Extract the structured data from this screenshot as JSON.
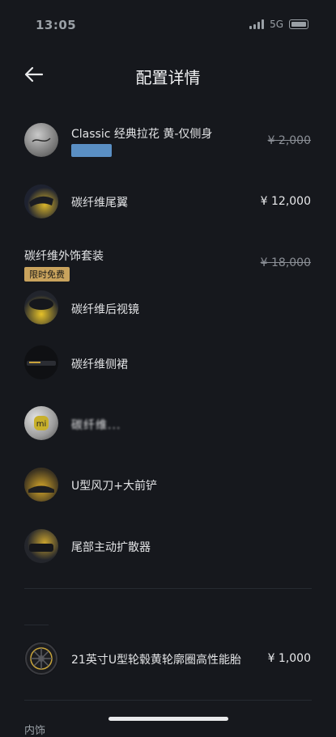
{
  "status": {
    "time": "13:05",
    "network": "5G"
  },
  "header": {
    "title": "配置详情"
  },
  "items": [
    {
      "name": "Classic 经典拉花 黄-仅侧身",
      "price": "¥ 2,000",
      "strikethrough": true,
      "thumb": "decal-thumb-icon"
    },
    {
      "name": "碳纤维尾翼",
      "price": "¥ 12,000",
      "strikethrough": false,
      "thumb": "spoiler-thumb-icon"
    },
    {
      "name": "碳纤维后视镜",
      "thumb": "mirror-thumb-icon"
    },
    {
      "name": "碳纤维侧裙",
      "thumb": "side-skirt-thumb-icon"
    },
    {
      "name": "碳纤维...",
      "thumb": "logo-badge-thumb-icon"
    },
    {
      "name": "U型风刀+大前铲",
      "thumb": "front-splitter-thumb-icon"
    },
    {
      "name": "尾部主动扩散器",
      "thumb": "diffuser-thumb-icon"
    },
    {
      "name": "21英寸U型轮毂黄轮廓圈高性能胎",
      "price": "¥ 1,000",
      "strikethrough": false,
      "thumb": "wheel-thumb-icon"
    }
  ],
  "package": {
    "title": "碳纤维外饰套装",
    "badge": "限时免费",
    "price": "¥ 18,000",
    "strikethrough": true
  },
  "footer": {
    "label": "内饰"
  },
  "colors": {
    "accent_gold": "#c9a35d",
    "bg": "#16181d",
    "badge_blue": "#5a8fc4"
  }
}
